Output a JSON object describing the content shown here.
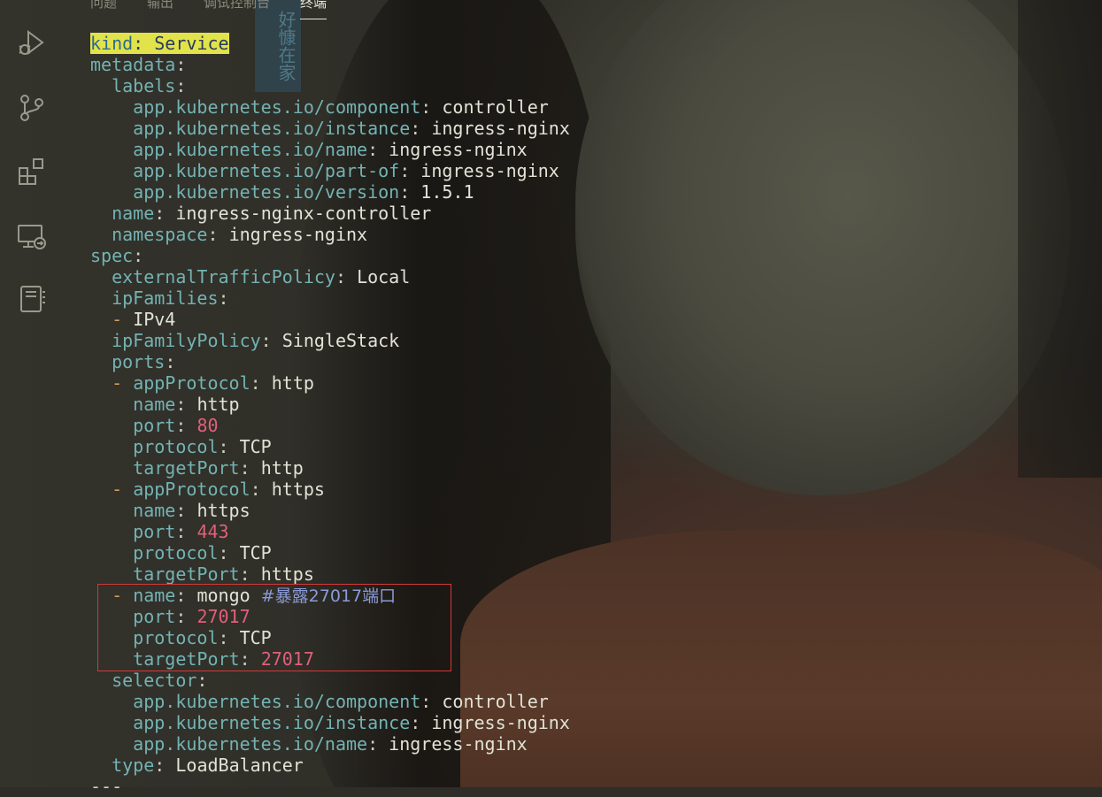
{
  "panel": {
    "tabs": [
      {
        "label": "问题",
        "active": false
      },
      {
        "label": "输出",
        "active": false
      },
      {
        "label": "调试控制台",
        "active": false
      },
      {
        "label": "终端",
        "active": true
      }
    ]
  },
  "activity_bar": {
    "icons": [
      "run-debug-icon",
      "source-control-icon",
      "extensions-icon",
      "remote-explorer-icon",
      "notebook-icon"
    ]
  },
  "background": {
    "stamp_text": "好慷在家"
  },
  "editor": {
    "lines": [
      {
        "indent": "",
        "key": "kind",
        "value": "Service",
        "highlight": true
      },
      {
        "indent": "",
        "key": "metadata",
        "value": ""
      },
      {
        "indent": "  ",
        "key": "labels",
        "value": ""
      },
      {
        "indent": "    ",
        "key": "app.kubernetes.io/component",
        "value": "controller"
      },
      {
        "indent": "    ",
        "key": "app.kubernetes.io/instance",
        "value": "ingress-nginx"
      },
      {
        "indent": "    ",
        "key": "app.kubernetes.io/name",
        "value": "ingress-nginx"
      },
      {
        "indent": "    ",
        "key": "app.kubernetes.io/part-of",
        "value": "ingress-nginx"
      },
      {
        "indent": "    ",
        "key": "app.kubernetes.io/version",
        "value": "1.5.1"
      },
      {
        "indent": "  ",
        "key": "name",
        "value": "ingress-nginx-controller"
      },
      {
        "indent": "  ",
        "key": "namespace",
        "value": "ingress-nginx"
      },
      {
        "indent": "",
        "key": "spec",
        "value": ""
      },
      {
        "indent": "  ",
        "key": "externalTrafficPolicy",
        "value": "Local"
      },
      {
        "indent": "  ",
        "key": "ipFamilies",
        "value": ""
      },
      {
        "indent": "  ",
        "dash": true,
        "key": "",
        "value": "IPv4"
      },
      {
        "indent": "  ",
        "key": "ipFamilyPolicy",
        "value": "SingleStack"
      },
      {
        "indent": "  ",
        "key": "ports",
        "value": ""
      },
      {
        "indent": "  ",
        "dash": true,
        "key": "appProtocol",
        "value": "http"
      },
      {
        "indent": "    ",
        "key": "name",
        "value": "http"
      },
      {
        "indent": "    ",
        "key": "port",
        "value": "80",
        "number": true
      },
      {
        "indent": "    ",
        "key": "protocol",
        "value": "TCP"
      },
      {
        "indent": "    ",
        "key": "targetPort",
        "value": "http"
      },
      {
        "indent": "  ",
        "dash": true,
        "key": "appProtocol",
        "value": "https"
      },
      {
        "indent": "    ",
        "key": "name",
        "value": "https"
      },
      {
        "indent": "    ",
        "key": "port",
        "value": "443",
        "number": true
      },
      {
        "indent": "    ",
        "key": "protocol",
        "value": "TCP"
      },
      {
        "indent": "    ",
        "key": "targetPort",
        "value": "https"
      },
      {
        "indent": "  ",
        "dash": true,
        "key": "name",
        "value": "mongo",
        "comment": "#暴露27017端口"
      },
      {
        "indent": "    ",
        "key": "port",
        "value": "27017",
        "number": true
      },
      {
        "indent": "    ",
        "key": "protocol",
        "value": "TCP"
      },
      {
        "indent": "    ",
        "key": "targetPort",
        "value": "27017",
        "number": true
      },
      {
        "indent": "  ",
        "key": "selector",
        "value": ""
      },
      {
        "indent": "    ",
        "key": "app.kubernetes.io/component",
        "value": "controller"
      },
      {
        "indent": "    ",
        "key": "app.kubernetes.io/instance",
        "value": "ingress-nginx"
      },
      {
        "indent": "    ",
        "key": "app.kubernetes.io/name",
        "value": "ingress-nginx"
      },
      {
        "indent": "  ",
        "key": "type",
        "value": "LoadBalancer"
      },
      {
        "indent": "",
        "key": "",
        "value": "---",
        "partial": true
      }
    ]
  },
  "colors": {
    "key": "#73b3b3",
    "value": "#e2e2d6",
    "number": "#e0607a",
    "dash": "#d09d5c",
    "comment": "#8a9bd8",
    "highlight": "#e2e34a",
    "annotation_box": "#d23a3a"
  }
}
